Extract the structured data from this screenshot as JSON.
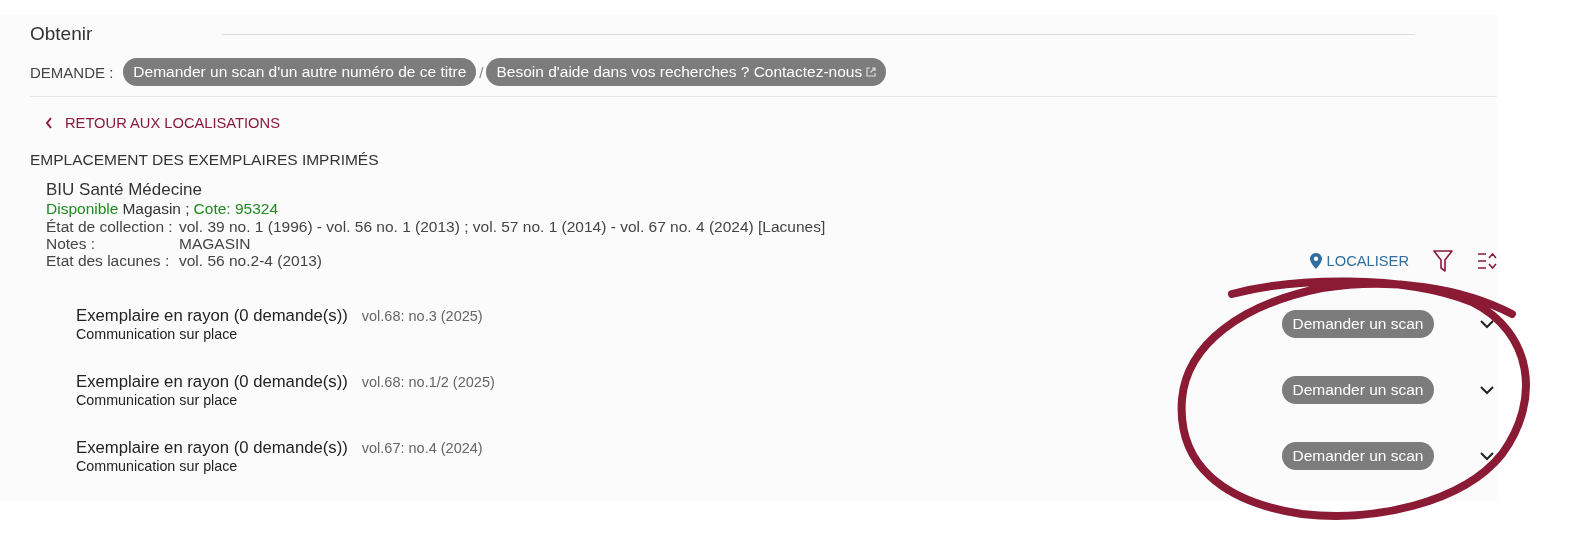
{
  "section_title": "Obtenir",
  "request": {
    "label": "DEMANDE :",
    "separator": "/",
    "buttons": [
      {
        "label": "Demander un scan d'un autre numéro de ce titre",
        "external": false
      },
      {
        "label": "Besoin d'aide dans vos recherches ? Contactez-nous",
        "external": true
      }
    ]
  },
  "back_link": "RETOUR AUX LOCALISATIONS",
  "heading": "EMPLACEMENT DES EXEMPLAIRES IMPRIMÉS",
  "library": {
    "name": "BIU Santé Médecine",
    "status": "Disponible",
    "location": "Magasin ;",
    "shelfmark": "Cote: 95324",
    "details": [
      {
        "label": "État de collection :",
        "value": "vol. 39 no. 1 (1996) - vol. 56 no. 1 (2013) ; vol. 57 no. 1 (2014) - vol. 67 no. 4 (2024) [Lacunes]"
      },
      {
        "label": "Notes :",
        "value": "MAGASIN"
      },
      {
        "label": "Etat des lacunes :",
        "value": "vol. 56 no.2-4 (2013)"
      }
    ]
  },
  "tools": {
    "locate": "LOCALISER"
  },
  "items": [
    {
      "title": "Exemplaire en rayon (0 demande(s))",
      "issue": "vol.68: no.3 (2025)",
      "policy": "Communication sur place",
      "button": "Demander un scan",
      "expanded": false
    },
    {
      "title": "Exemplaire en rayon (0 demande(s))",
      "issue": "vol.68: no.1/2 (2025)",
      "policy": "Communication sur place",
      "button": "Demander un scan",
      "expanded": false
    },
    {
      "title": "Exemplaire en rayon (0 demande(s))",
      "issue": "vol.67: no.4 (2024)",
      "policy": "Communication sur place",
      "button": "Demander un scan",
      "expanded": false
    }
  ]
}
